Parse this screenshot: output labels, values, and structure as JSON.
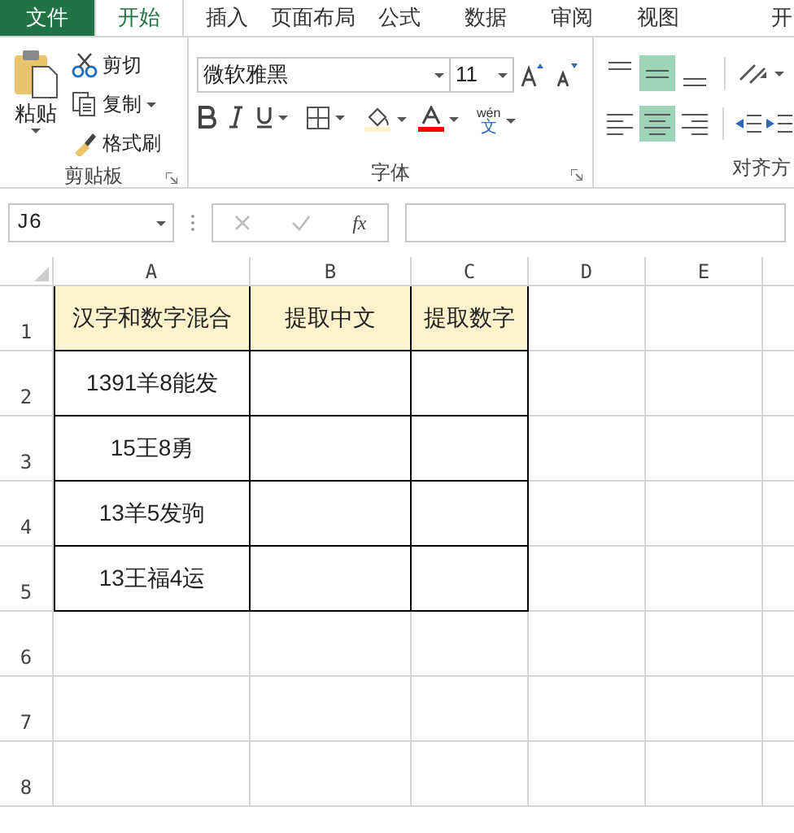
{
  "tabs": [
    {
      "label": "文件",
      "kind": "file",
      "selected": false
    },
    {
      "label": "开始",
      "kind": "tab",
      "selected": true
    },
    {
      "label": "插入",
      "kind": "tab",
      "selected": false
    },
    {
      "label": "页面布局",
      "kind": "tab",
      "selected": false
    },
    {
      "label": "公式",
      "kind": "tab",
      "selected": false
    },
    {
      "label": "数据",
      "kind": "tab",
      "selected": false
    },
    {
      "label": "审阅",
      "kind": "tab",
      "selected": false
    },
    {
      "label": "视图",
      "kind": "tab",
      "selected": false
    },
    {
      "label": "开",
      "kind": "cut",
      "selected": false
    }
  ],
  "clipboard": {
    "paste": "粘贴",
    "cut": "剪切",
    "copy": "复制",
    "format_painter": "格式刷",
    "label": "剪贴板"
  },
  "font": {
    "name": "微软雅黑",
    "size": "11",
    "label": "字体",
    "phonetic": "wén",
    "phonetic_char": "文"
  },
  "alignment": {
    "label": "对齐方",
    "buttons": [
      {
        "kind": "top",
        "selected": false
      },
      {
        "kind": "middle",
        "selected": true
      },
      {
        "kind": "bottom",
        "selected": false
      },
      {
        "kind": "left",
        "selected": false
      },
      {
        "kind": "center",
        "selected": true
      },
      {
        "kind": "right",
        "selected": false
      }
    ]
  },
  "name_box": "J6",
  "fx": "fx",
  "sheet": {
    "columns": [
      "A",
      "B",
      "C",
      "D",
      "E"
    ],
    "row_numbers": [
      "1",
      "2",
      "3",
      "4",
      "5",
      "6",
      "7",
      "8"
    ],
    "header": [
      "汉字和数字混合",
      "提取中文",
      "提取数字"
    ],
    "rows": [
      {
        "mixed": "1391羊8能发"
      },
      {
        "mixed": "15王8勇"
      },
      {
        "mixed": "13羊5发驹"
      },
      {
        "mixed": "13王福4运"
      }
    ]
  }
}
